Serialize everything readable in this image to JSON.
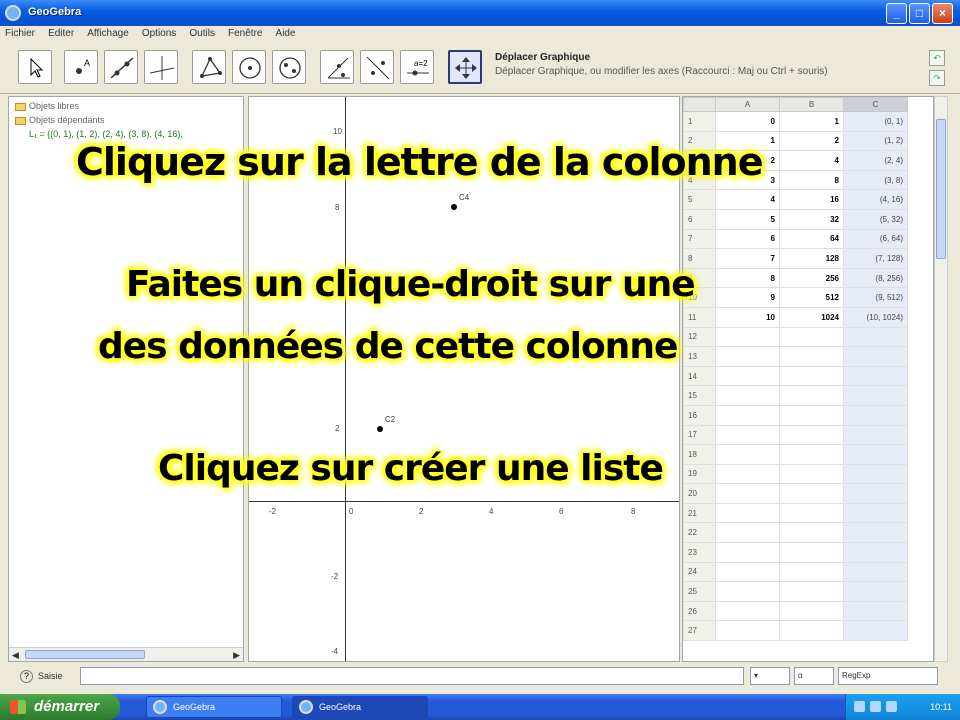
{
  "window": {
    "title": "GeoGebra"
  },
  "menu": [
    "Fichier",
    "Editer",
    "Affichage",
    "Options",
    "Outils",
    "Fenêtre",
    "Aide"
  ],
  "tool_info": {
    "name": "Déplacer Graphique",
    "description": "Déplacer Graphique, ou modifier les axes (Raccourci : Maj ou Ctrl + souris)"
  },
  "algebra": {
    "free_objects": "Objets libres",
    "dependent_objects": "Objets dépendants",
    "list_item": "L₁ = {(0, 1), (1, 2), (2, 4), (3, 8), (4, 16),"
  },
  "graphics": {
    "x_ticks": [
      "-2",
      "0",
      "2",
      "4",
      "6",
      "8"
    ],
    "y_ticks": [
      "10",
      "8",
      "2",
      "-2",
      "-4"
    ],
    "points": [
      {
        "label": "C4"
      },
      {
        "label": "C2"
      }
    ]
  },
  "sheet": {
    "columns": [
      "A",
      "B",
      "C"
    ],
    "rows": [
      [
        "1",
        "0",
        "1",
        "(0, 1)"
      ],
      [
        "2",
        "1",
        "2",
        "(1, 2)"
      ],
      [
        "3",
        "2",
        "4",
        "(2, 4)"
      ],
      [
        "4",
        "3",
        "8",
        "(3, 8)"
      ],
      [
        "5",
        "4",
        "16",
        "(4, 16)"
      ],
      [
        "6",
        "5",
        "32",
        "(5, 32)"
      ],
      [
        "7",
        "6",
        "64",
        "(6, 64)"
      ],
      [
        "8",
        "7",
        "128",
        "(7, 128)"
      ],
      [
        "9",
        "8",
        "256",
        "(8, 256)"
      ],
      [
        "10",
        "9",
        "512",
        "(9, 512)"
      ],
      [
        "11",
        "10",
        "1024",
        "(10, 1024)"
      ],
      [
        "12",
        "",
        "",
        ""
      ],
      [
        "13",
        "",
        "",
        ""
      ],
      [
        "14",
        "",
        "",
        ""
      ],
      [
        "15",
        "",
        "",
        ""
      ],
      [
        "16",
        "",
        "",
        ""
      ],
      [
        "17",
        "",
        "",
        ""
      ],
      [
        "18",
        "",
        "",
        ""
      ],
      [
        "19",
        "",
        "",
        ""
      ],
      [
        "20",
        "",
        "",
        ""
      ],
      [
        "21",
        "",
        "",
        ""
      ],
      [
        "22",
        "",
        "",
        ""
      ],
      [
        "23",
        "",
        "",
        ""
      ],
      [
        "24",
        "",
        "",
        ""
      ],
      [
        "25",
        "",
        "",
        ""
      ],
      [
        "26",
        "",
        "",
        ""
      ],
      [
        "27",
        "",
        "",
        ""
      ]
    ]
  },
  "input_bar": {
    "label": "Saisie",
    "symbol_select": "α",
    "command_select": "RegExp"
  },
  "taskbar": {
    "start_label": "démarrer",
    "tasks": [
      "GeoGebra",
      "GeoGebra"
    ],
    "clock": "10:11"
  },
  "captions": {
    "line1": "Cliquez sur la lettre de la colonne",
    "line2": "Faites un clique-droit sur une",
    "line3": "des données de cette colonne",
    "line4": "Cliquez sur créer une liste"
  },
  "colors": {
    "caption_glow": "#ffff00",
    "title_bar": "#0553d8",
    "list_text": "#1a7c1a"
  },
  "icons": [
    "geogebra-icon",
    "move-icon",
    "point-icon",
    "line-icon",
    "perpendicular-icon",
    "polygon-icon",
    "circle-icon",
    "conic-icon",
    "angle-icon",
    "reflect-icon",
    "slider-icon",
    "move-graphics-icon"
  ]
}
